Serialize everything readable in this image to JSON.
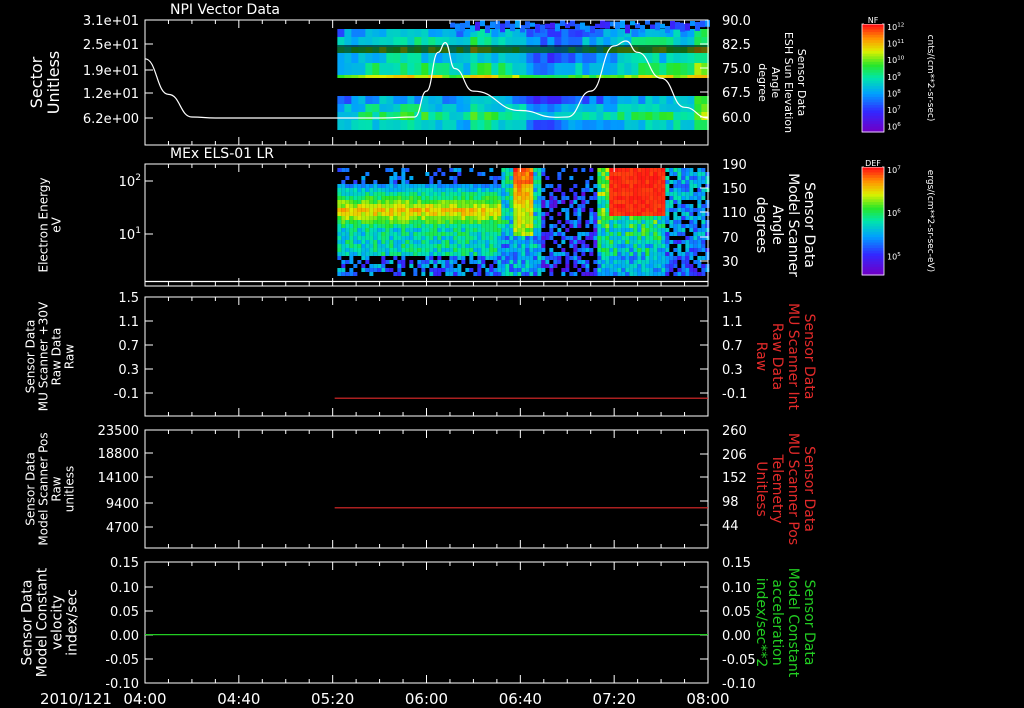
{
  "colors": {
    "background": "#000000",
    "axis": "#ffffff",
    "trace_red": "#e32a2a",
    "trace_green": "#22cc22",
    "line_white": "#ffffff"
  },
  "time_axis": {
    "date_label": "2010/121",
    "ticks": [
      "04:00",
      "04:40",
      "05:20",
      "06:00",
      "06:40",
      "07:20",
      "08:00"
    ],
    "start_min": 240,
    "end_min": 480
  },
  "panels": [
    {
      "id": "npi",
      "title": "NPI Vector Data",
      "left_label": [
        "Sector",
        "Unitless"
      ],
      "left_ticks": [
        "3.1e+01",
        "2.5e+01",
        "1.9e+01",
        "1.2e+01",
        "6.2e+00"
      ],
      "right_label": [
        "Sensor Data",
        "ESH Sun Elevation",
        "Angle",
        "degree"
      ],
      "right_ticks": [
        "90.0",
        "82.5",
        "75.0",
        "67.5",
        "60.0"
      ],
      "colorbar": {
        "tag": "NF",
        "top": "10^12",
        "labels": [
          "10^11",
          "10^10",
          "10^9",
          "10^8",
          "10^7",
          "10^6"
        ],
        "unit": "cnts/(cm**2-sr-sec)"
      }
    },
    {
      "id": "els",
      "title": "MEx ELS-01 LR",
      "left_label": [
        "Electron Energy",
        "eV"
      ],
      "left_ticks": [
        "10^2",
        "10^1"
      ],
      "right_label": [
        "Sensor Data",
        "Model Scanner",
        "Angle",
        "degrees"
      ],
      "right_ticks": [
        "190",
        "150",
        "110",
        "70",
        "30"
      ],
      "colorbar": {
        "tag": "DEF",
        "top": "10^7",
        "labels": [
          "10^6",
          "10^5"
        ],
        "unit": "ergs/(cm**2-sr-sec-eV)"
      }
    },
    {
      "id": "mu_int",
      "left_label": [
        "Sensor Data",
        "MU Scanner +30V",
        "Raw Data",
        "Raw"
      ],
      "left_ticks": [
        "1.5",
        "1.1",
        "0.7",
        "0.3",
        "-0.1"
      ],
      "right_label": [
        "Sensor Data",
        "MU Scanner Int",
        "Raw Data",
        "Raw"
      ],
      "right_ticks": [
        "1.5",
        "1.1",
        "0.7",
        "0.3",
        "-0.1"
      ]
    },
    {
      "id": "mu_pos",
      "left_label": [
        "Sensor Data",
        "Model Scanner Pos",
        "Raw",
        "unitless"
      ],
      "left_ticks": [
        "23500",
        "18800",
        "14100",
        "9400",
        "4700"
      ],
      "right_label": [
        "Sensor Data",
        "MU Scanner Pos",
        "Telemetry",
        "Unitless"
      ],
      "right_ticks": [
        "260",
        "206",
        "152",
        "98",
        "44"
      ]
    },
    {
      "id": "model_const",
      "left_label": [
        "Sensor Data",
        "Model Constant",
        "velocity",
        "index/sec"
      ],
      "left_ticks": [
        "0.15",
        "0.10",
        "0.05",
        "0.00",
        "-0.05",
        "-0.10"
      ],
      "right_label": [
        "Sensor Data",
        "Model Constant",
        "acceleration",
        "index/sec**2"
      ],
      "right_ticks": [
        "0.15",
        "0.10",
        "0.05",
        "0.00",
        "-0.05",
        "-0.10"
      ]
    }
  ],
  "chart_data": [
    {
      "type": "heatmap",
      "title": "NPI Vector Data",
      "ylabel": "Sector Unitless",
      "y2label": "Sensor Data ESH Sun Elevation Angle degree",
      "ylim": [
        0,
        31
      ],
      "y2lim": [
        55,
        90
      ],
      "data_start": "05:22",
      "data_end": "08:00",
      "sun_elevation_line": {
        "x": [
          "04:00",
          "04:10",
          "04:20",
          "04:30",
          "05:00",
          "05:20",
          "05:40",
          "05:55",
          "06:00",
          "06:05",
          "06:08",
          "06:12",
          "06:20",
          "06:40",
          "06:55",
          "07:00",
          "07:10",
          "07:20",
          "07:25",
          "07:30",
          "07:40",
          "07:50",
          "08:00"
        ],
        "y": [
          78,
          67,
          60,
          59.7,
          59.7,
          59.7,
          59.7,
          60,
          68,
          80,
          83,
          75,
          68,
          62,
          59.9,
          60,
          68,
          82,
          83.5,
          80,
          72,
          63,
          59.7
        ]
      }
    },
    {
      "type": "heatmap",
      "title": "MEx ELS-01 LR",
      "ylabel": "Electron Energy eV",
      "y2label": "Sensor Data Model Scanner Angle degrees",
      "y_scale": "log",
      "ylim": [
        1,
        150
      ],
      "y2lim": [
        0,
        190
      ],
      "data_start": "05:22",
      "data_end": "08:00",
      "scanner_angle_line": {
        "x": [
          "04:00",
          "08:00"
        ],
        "y": [
          7,
          7
        ]
      }
    },
    {
      "type": "line",
      "ylabel": "Sensor Data MU Scanner +30V Raw Data Raw",
      "y2label": "Sensor Data MU Scanner Int Raw Data Raw",
      "ylim": [
        -0.3,
        1.5
      ],
      "series": [
        {
          "x": [
            "05:20",
            "08:00"
          ],
          "y": [
            0.0,
            0.0
          ],
          "color": "#e32a2a"
        }
      ]
    },
    {
      "type": "line",
      "ylabel": "Sensor Data Model Scanner Pos Raw unitless",
      "y2label": "Sensor Data MU Scanner Pos Telemetry Unitless",
      "ylim": [
        0,
        23500
      ],
      "y2lim": [
        0,
        260
      ],
      "series": [
        {
          "x": [
            "05:20",
            "08:00"
          ],
          "y": [
            8000,
            8000
          ],
          "color": "#e32a2a"
        }
      ]
    },
    {
      "type": "line",
      "ylabel": "Sensor Data Model Constant velocity index/sec",
      "y2label": "Sensor Data Model Constant acceleration index/sec**2",
      "ylim": [
        -0.1,
        0.15
      ],
      "series": [
        {
          "x": [
            "04:00",
            "08:00"
          ],
          "y": [
            0.0,
            0.0
          ],
          "color": "#22cc22"
        }
      ]
    }
  ]
}
